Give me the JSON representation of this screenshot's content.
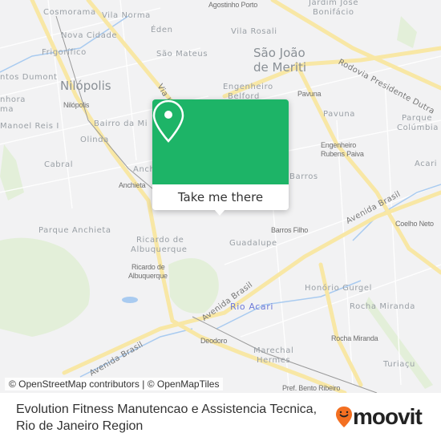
{
  "map": {
    "labels": {
      "agostinho_porto": "Agostinho Porto",
      "jardim_jose_bonifacio_1": "Jardim José",
      "jardim_jose_bonifacio_2": "Bonifácio",
      "cosmorama": "Cosmorama",
      "vila_norma": "Vila Norma",
      "eden": "Éden",
      "vila_rosali": "Vila Rosali",
      "nova_cidade": "Nova Cidade",
      "frigorifico": "Frigorífico",
      "sao_mateus": "São Mateus",
      "sao_joao_1": "São João",
      "sao_joao_2": "de Meriti",
      "santos_dumont": "ntos Dumont",
      "nilopolis": "Nilópolis",
      "nilopolis_station": "Nilópolis",
      "eng_belford_1": "Engenheiro",
      "eng_belford_2": "Belford",
      "pavuna_station": "Pavuna",
      "senhora_1": "nhora",
      "senhora_2": "ma",
      "pavuna": "Pavuna",
      "parque_columbia_1": "Parque",
      "parque_columbia_2": "Colúmbia",
      "manoel_reis": "Manoel Reis I",
      "bairro_da_mina": "Bairro da Mi",
      "olinda": "Olinda",
      "eng_rubens_1": "Engenheiro",
      "eng_rubens_2": "Rubens Paiva",
      "cabral": "Cabral",
      "acari": "Acari",
      "anchieta": "Anch",
      "anchieta_station": "Anchieta",
      "barros": "Barros",
      "coelho_neto": "Coelho Neto",
      "parque_anchieta": "Parque Anchieta",
      "ricardo_1": "Ricardo de",
      "ricardo_2": "Albuquerque",
      "barros_filho": "Barros Filho",
      "guadalupe": "Guadalupe",
      "ricardo_st_1": "Ricardo de",
      "ricardo_st_2": "Albuquerque",
      "honorio_gurgel": "Honório Gurgel",
      "rio_acari": "Rio Acari",
      "rocha_miranda": "Rocha Miranda",
      "deodoro": "Deodoro",
      "rocha_miranda_station": "Rocha Miranda",
      "marechal_1": "Marechal",
      "marechal_2": "Hermes",
      "turiacu": "Turiaçu",
      "bento_ribeiro": "Pref. Bento Ribeiro",
      "via_light": "Via L",
      "rodovia_dutra": "Rodovia Presidente Dutra",
      "av_brasil_1": "Avenida Brasil",
      "av_brasil_2": "Avenida Brasil",
      "av_brasil_3": "Avenida Brasil"
    },
    "attribution": "© OpenStreetMap contributors | © OpenMapTiles"
  },
  "popup": {
    "icon": "map-pin-icon",
    "button_label": "Take me there",
    "color": "#1db467"
  },
  "footer": {
    "title_line1": "Evolution Fitness Manutencao e Assistencia Tecnica,",
    "title_line2": "Rio de Janeiro Region",
    "logo_text": "moovit",
    "logo_color": "#f36f21"
  }
}
